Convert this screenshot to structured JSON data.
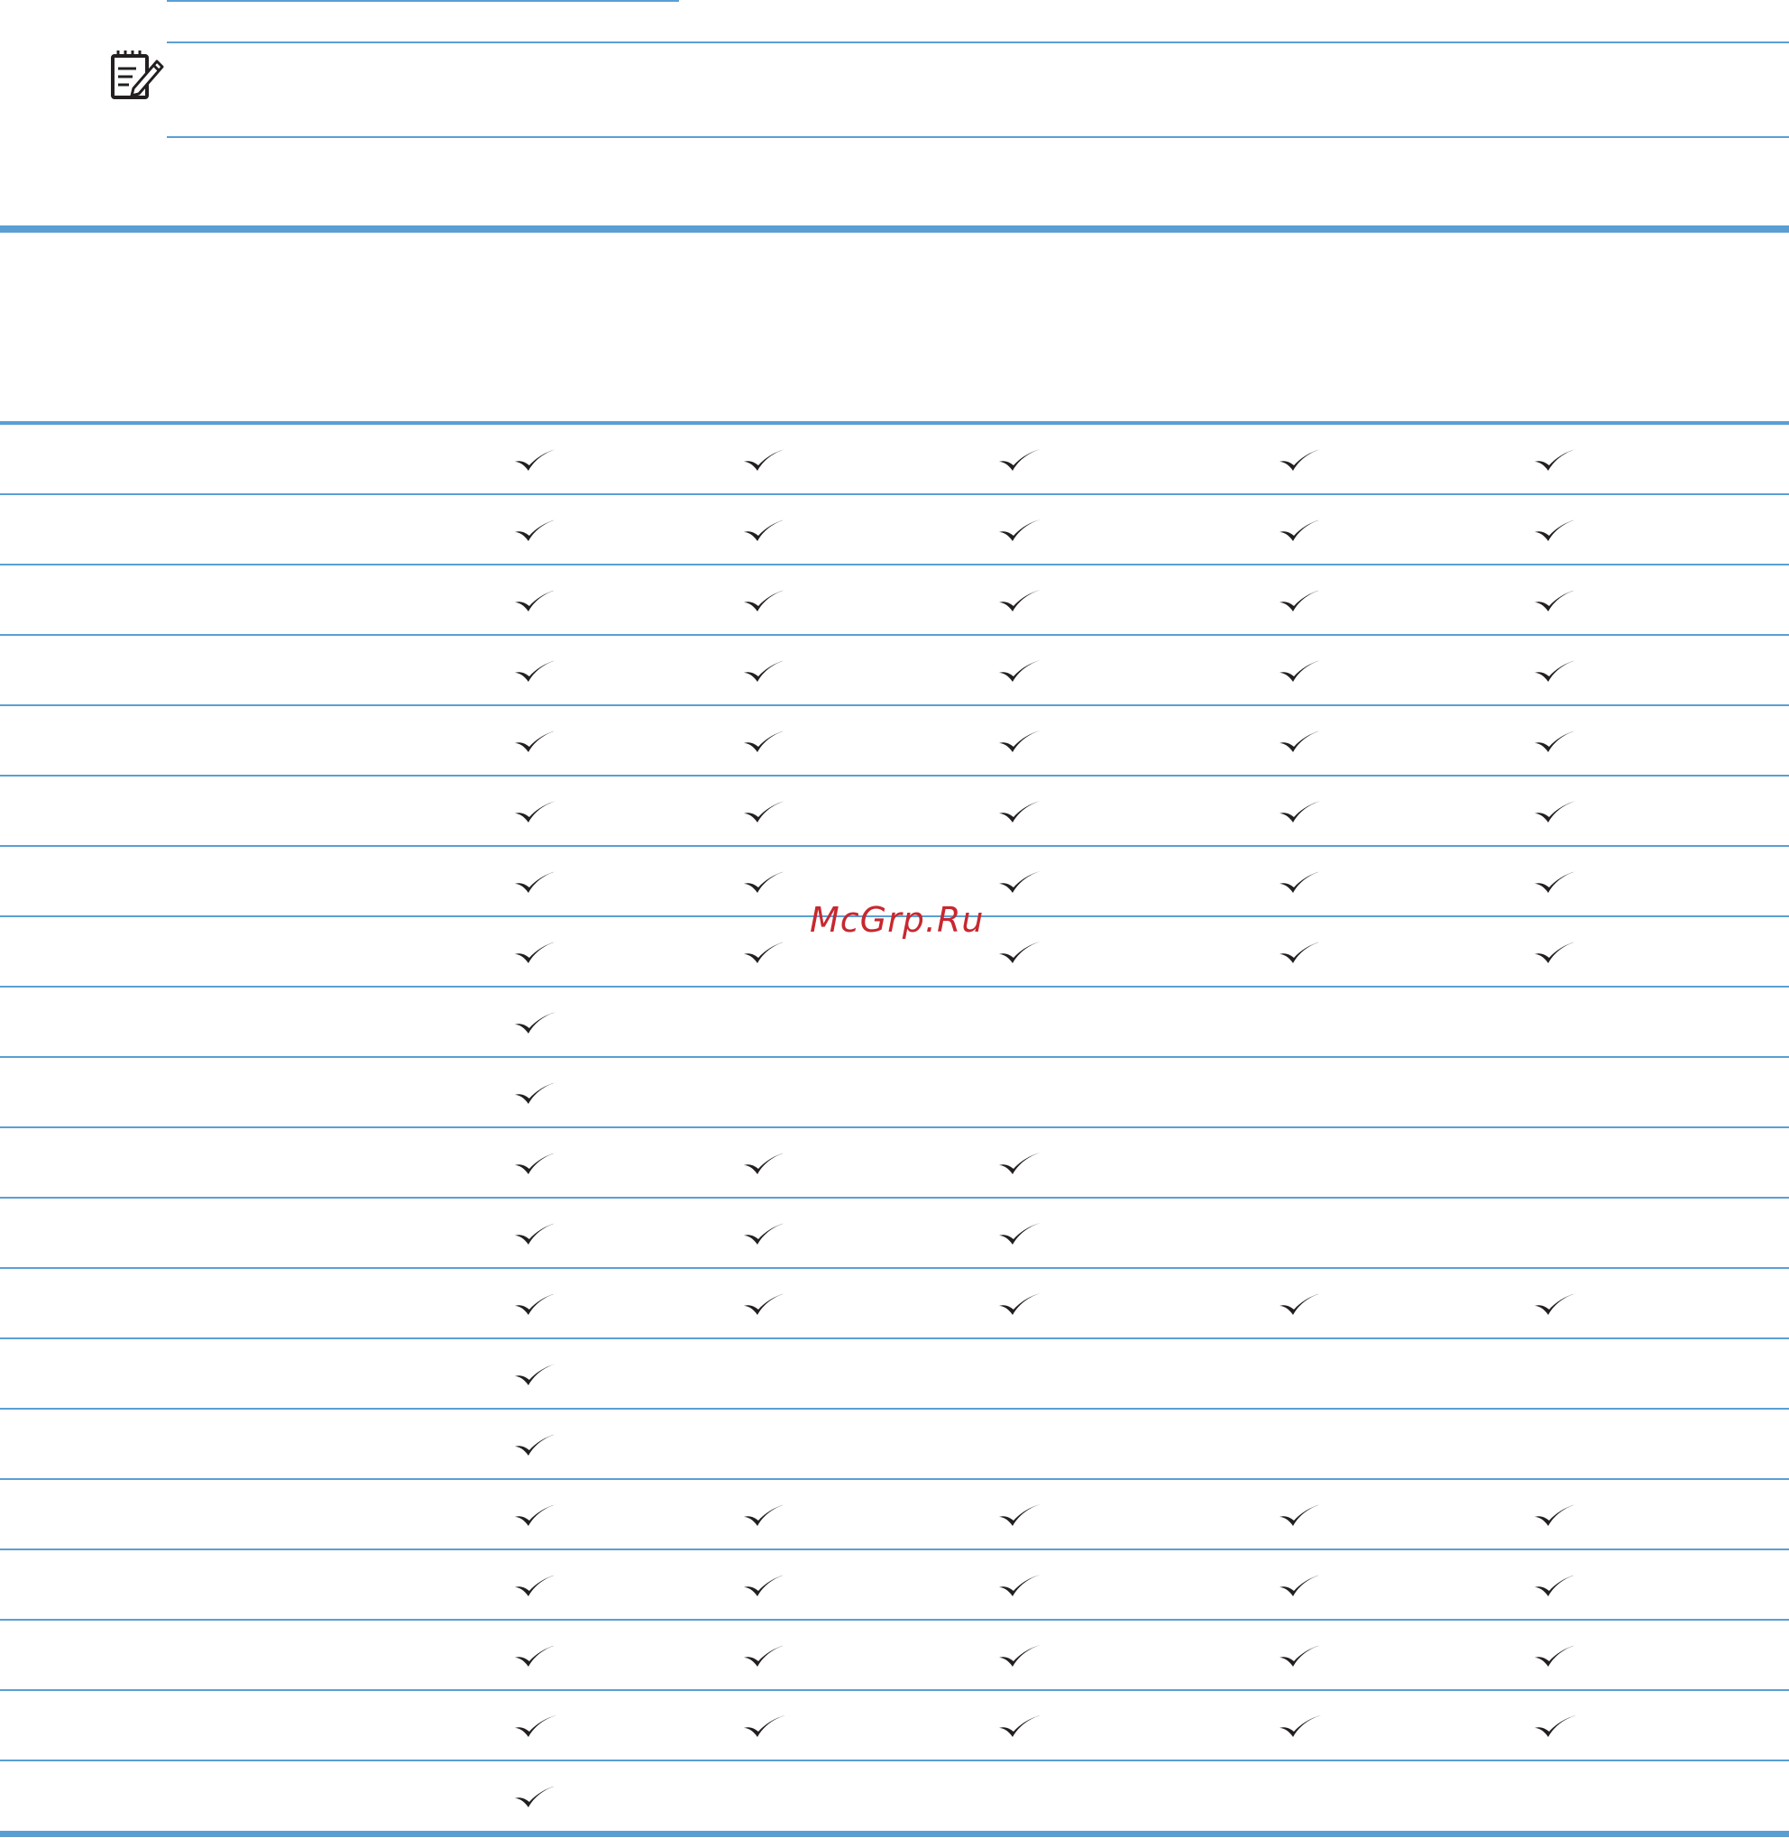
{
  "watermark": "McGrp.Ru",
  "note": {
    "icon": "note-pencil-icon"
  },
  "colors": {
    "rule": "#5a9fd4",
    "check": "#231f20",
    "watermark": "#c8272f"
  },
  "table": {
    "columns": 5,
    "rows": [
      [
        true,
        true,
        true,
        true,
        true
      ],
      [
        true,
        true,
        true,
        true,
        true
      ],
      [
        true,
        true,
        true,
        true,
        true
      ],
      [
        true,
        true,
        true,
        true,
        true
      ],
      [
        true,
        true,
        true,
        true,
        true
      ],
      [
        true,
        true,
        true,
        true,
        true
      ],
      [
        true,
        true,
        true,
        true,
        true
      ],
      [
        true,
        true,
        true,
        true,
        true
      ],
      [
        true,
        false,
        false,
        false,
        false
      ],
      [
        true,
        false,
        false,
        false,
        false
      ],
      [
        true,
        true,
        true,
        false,
        false
      ],
      [
        true,
        true,
        true,
        false,
        false
      ],
      [
        true,
        true,
        true,
        true,
        true
      ],
      [
        true,
        false,
        false,
        false,
        false
      ],
      [
        true,
        false,
        false,
        false,
        false
      ],
      [
        true,
        true,
        true,
        true,
        true
      ],
      [
        true,
        true,
        true,
        true,
        true
      ],
      [
        true,
        true,
        true,
        true,
        true
      ],
      [
        true,
        true,
        true,
        true,
        true
      ],
      [
        true,
        false,
        false,
        false,
        false
      ]
    ]
  }
}
